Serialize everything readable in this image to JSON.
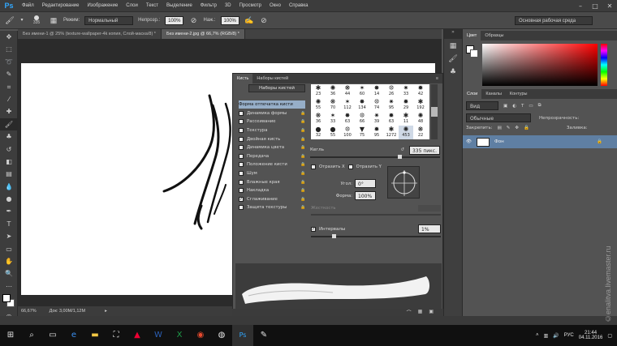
{
  "app": {
    "logo": "Ps"
  },
  "menu": [
    "Файл",
    "Редактирование",
    "Изображение",
    "Слои",
    "Текст",
    "Выделение",
    "Фильтр",
    "3D",
    "Просмотр",
    "Окно",
    "Справка"
  ],
  "window_controls": [
    "–",
    "□",
    "✕"
  ],
  "options": {
    "brush_size": "335",
    "mode_label": "Режим:",
    "mode_value": "Нормальный",
    "opacity_label": "Непрозр.:",
    "opacity_value": "100%",
    "flow_label": "Наж.:",
    "flow_value": "100%",
    "workspace": "Основная рабочая среда"
  },
  "doc_tabs": [
    {
      "label": "Без имени-1 @ 25% (texture-wallpaper-4k копия, Слой-маска/8) *",
      "active": false
    },
    {
      "label": "Без имени-2.jpg @ 66,7% (RGB/8) *",
      "active": true
    }
  ],
  "status": {
    "zoom": "66,67%",
    "doc_size": "Док: 3,00M/1,12M"
  },
  "brush_panel": {
    "tabs": [
      "Кисть",
      "Наборы кистей"
    ],
    "presets_button": "Наборы кистей",
    "options": [
      {
        "label": "Форма отпечатка кисти",
        "checked": false,
        "selected": true,
        "lock": false
      },
      {
        "label": "Динамика формы",
        "checked": false,
        "selected": false,
        "lock": true
      },
      {
        "label": "Рассеивание",
        "checked": false,
        "selected": false,
        "lock": true
      },
      {
        "label": "Текстура",
        "checked": false,
        "selected": false,
        "lock": true
      },
      {
        "label": "Двойная кисть",
        "checked": false,
        "selected": false,
        "lock": true
      },
      {
        "label": "Динамика цвета",
        "checked": false,
        "selected": false,
        "lock": true
      },
      {
        "label": "Передача",
        "checked": false,
        "selected": false,
        "lock": true
      },
      {
        "label": "Положение кисти",
        "checked": false,
        "selected": false,
        "lock": true
      },
      {
        "label": "Шум",
        "checked": false,
        "selected": false,
        "lock": true
      },
      {
        "label": "Влажные края",
        "checked": false,
        "selected": false,
        "lock": true
      },
      {
        "label": "Накладка",
        "checked": false,
        "selected": false,
        "lock": true
      },
      {
        "label": "Сглаживание",
        "checked": true,
        "selected": false,
        "lock": true
      },
      {
        "label": "Защита текстуры",
        "checked": false,
        "selected": false,
        "lock": true
      }
    ],
    "grid_rows": [
      [
        "23",
        "36",
        "44",
        "60",
        "14",
        "26",
        "33",
        "42"
      ],
      [
        "55",
        "70",
        "112",
        "134",
        "74",
        "95",
        "29",
        "192"
      ],
      [
        "36",
        "33",
        "63",
        "66",
        "39",
        "63",
        "11",
        "48"
      ],
      [
        "32",
        "55",
        "100",
        "75",
        "95",
        "1272",
        "453",
        "22"
      ]
    ],
    "size_label": "Кегль",
    "size_value": "335 пикс.",
    "flip_x": "Отразить X",
    "flip_y": "Отразить Y",
    "angle_label": "Угол:",
    "angle_value": "0°",
    "roundness_label": "Форма:",
    "roundness_value": "100%",
    "hardness_label": "Жесткость",
    "spacing_label": "Интервалы",
    "spacing_checked": true,
    "spacing_value": "1%"
  },
  "right_panels": {
    "color_tabs": [
      "Цвет",
      "Образцы"
    ],
    "layers_tabs": [
      "Слои",
      "Каналы",
      "Контуры"
    ],
    "kind_label": "Вид",
    "blend_mode": "Обычные",
    "opacity_label": "Непрозрачность:",
    "lock_label": "Закрепить:",
    "fill_label": "Заливка:",
    "layer_name": "Фон"
  },
  "taskbar": {
    "lang": "РУС",
    "time": "21:44",
    "date": "04.11.2016"
  },
  "watermark": "©enalitva.livemaster.ru",
  "colors": {
    "accent": "#31a8ff",
    "selected_row": "#96aec8",
    "layer_sel": "#5f7fa3"
  }
}
